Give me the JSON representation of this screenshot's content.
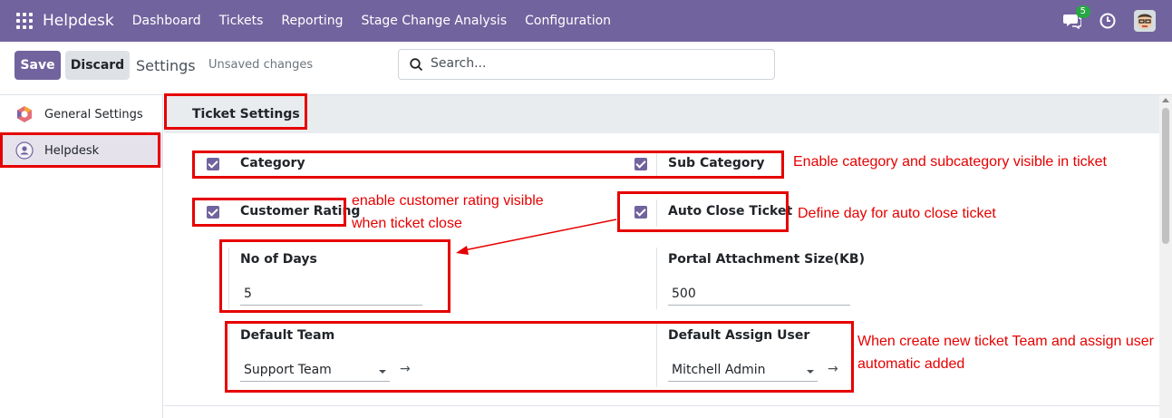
{
  "navbar": {
    "brand": "Helpdesk",
    "menu": [
      "Dashboard",
      "Tickets",
      "Reporting",
      "Stage Change Analysis",
      "Configuration"
    ],
    "chat_count": "5",
    "icons": [
      "apps-grid-icon",
      "chat-icon",
      "clock-icon",
      "user-avatar"
    ]
  },
  "controlbar": {
    "save_label": "Save",
    "discard_label": "Discard",
    "title": "Settings",
    "status": "Unsaved changes",
    "search_placeholder": "Search..."
  },
  "sidebar": {
    "items": [
      {
        "label": "General Settings",
        "icon": "odoo-logo-icon",
        "active": false
      },
      {
        "label": "Helpdesk",
        "icon": "helpdesk-icon",
        "active": true
      }
    ]
  },
  "section": {
    "title": "Ticket Settings"
  },
  "settings": {
    "category": {
      "label": "Category",
      "checked": true
    },
    "sub_category": {
      "label": "Sub Category",
      "checked": true
    },
    "customer_rating": {
      "label": "Customer Rating",
      "checked": true
    },
    "auto_close": {
      "label": "Auto Close Ticket",
      "checked": true
    },
    "no_of_days": {
      "label": "No of Days",
      "value": "5"
    },
    "portal_attachment": {
      "label": "Portal Attachment Size(KB)",
      "value": "500"
    },
    "default_team": {
      "label": "Default Team",
      "value": "Support Team"
    },
    "default_user": {
      "label": "Default Assign User",
      "value": "Mitchell Admin"
    }
  },
  "annotations": {
    "category_note": "Enable category and subcategory visible in ticket",
    "rating_note_1": "enable customer rating visible",
    "rating_note_2": "when ticket close",
    "autoclose_note": "Define day for auto close ticket",
    "team_note_1": "When create new ticket Team and assign user",
    "team_note_2": "automatic added",
    "color": "#e60000"
  },
  "colors": {
    "navbar": "#71639e",
    "accent": "#71639e",
    "annotation": "#e60000"
  }
}
